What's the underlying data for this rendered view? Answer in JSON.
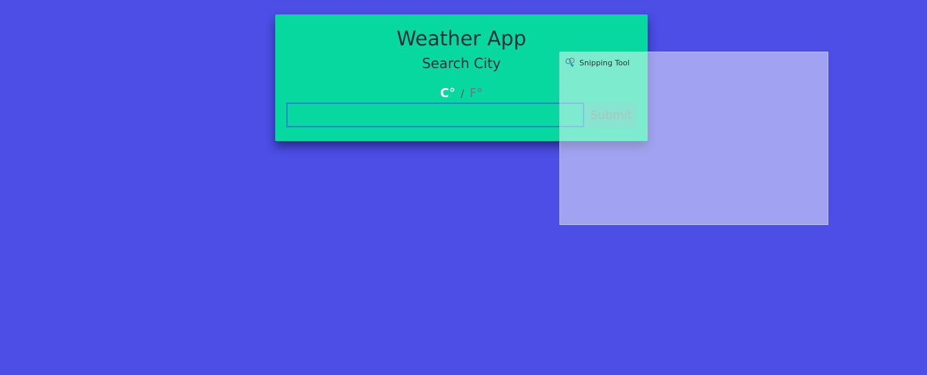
{
  "app": {
    "title": "Weather App",
    "subtitle": "Search City"
  },
  "units": {
    "celsius_label": "C°",
    "separator": "/",
    "fahrenheit_label": "F°",
    "selected": "celsius"
  },
  "search": {
    "value": "",
    "placeholder": "",
    "submit_label": "Submit"
  },
  "snipping_tool": {
    "label": "Snipping Tool",
    "icon": "scissors-icon"
  },
  "colors": {
    "background": "#4c4ee6",
    "card": "#07d8a0",
    "input_border": "#1e88c8"
  }
}
